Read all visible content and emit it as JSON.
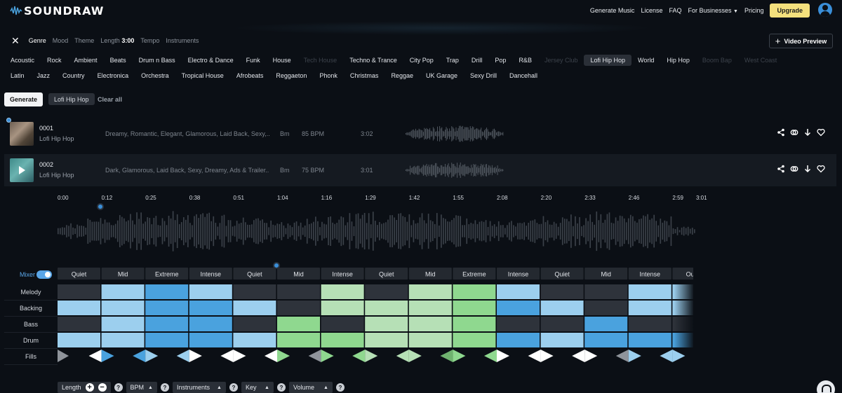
{
  "header": {
    "logo_text": "SOUNDRAW",
    "nav": [
      "Generate Music",
      "License",
      "FAQ",
      "For Businesses",
      "Pricing"
    ],
    "upgrade_label": "Upgrade"
  },
  "filters": {
    "genre": "Genre",
    "mood": "Mood",
    "theme": "Theme",
    "length_label": "Length",
    "length_value": "3:00",
    "tempo": "Tempo",
    "instruments": "Instruments",
    "video_preview": "Video Preview"
  },
  "genres_row1": [
    {
      "label": "Acoustic",
      "state": "normal"
    },
    {
      "label": "Rock",
      "state": "normal"
    },
    {
      "label": "Ambient",
      "state": "normal"
    },
    {
      "label": "Beats",
      "state": "normal"
    },
    {
      "label": "Drum n Bass",
      "state": "normal"
    },
    {
      "label": "Electro & Dance",
      "state": "normal"
    },
    {
      "label": "Funk",
      "state": "normal"
    },
    {
      "label": "House",
      "state": "normal"
    },
    {
      "label": "Tech House",
      "state": "dim"
    },
    {
      "label": "Techno & Trance",
      "state": "normal"
    },
    {
      "label": "City Pop",
      "state": "normal"
    },
    {
      "label": "Trap",
      "state": "normal"
    },
    {
      "label": "Drill",
      "state": "normal"
    },
    {
      "label": "Pop",
      "state": "normal"
    },
    {
      "label": "R&B",
      "state": "normal"
    },
    {
      "label": "Jersey Club",
      "state": "dim"
    },
    {
      "label": "Lofi Hip Hop",
      "state": "selected"
    },
    {
      "label": "World",
      "state": "normal"
    },
    {
      "label": "Hip Hop",
      "state": "normal"
    },
    {
      "label": "Boom Bap",
      "state": "dim"
    },
    {
      "label": "West Coast",
      "state": "dim"
    }
  ],
  "genres_row2": [
    {
      "label": "Latin",
      "state": "normal"
    },
    {
      "label": "Jazz",
      "state": "normal"
    },
    {
      "label": "Country",
      "state": "normal"
    },
    {
      "label": "Electronica",
      "state": "normal"
    },
    {
      "label": "Orchestra",
      "state": "normal"
    },
    {
      "label": "Tropical House",
      "state": "normal"
    },
    {
      "label": "Afrobeats",
      "state": "normal"
    },
    {
      "label": "Reggaeton",
      "state": "normal"
    },
    {
      "label": "Phonk",
      "state": "normal"
    },
    {
      "label": "Christmas",
      "state": "normal"
    },
    {
      "label": "Reggae",
      "state": "normal"
    },
    {
      "label": "UK Garage",
      "state": "normal"
    },
    {
      "label": "Sexy Drill",
      "state": "normal"
    },
    {
      "label": "Dancehall",
      "state": "normal"
    }
  ],
  "actions": {
    "generate": "Generate",
    "active_tag": "Lofi Hip Hop",
    "clear_all": "Clear all"
  },
  "tracks": [
    {
      "number": "0001",
      "genre": "Lofi Hip Hop",
      "tags": "Dreamy, Romantic, Elegant, Glamorous, Laid Back, Sexy,...",
      "key": "Bm",
      "bpm": "85 BPM",
      "duration": "3:02"
    },
    {
      "number": "0002",
      "genre": "Lofi Hip Hop",
      "tags": "Dark, Glamorous, Laid Back, Sexy, Dreamy, Ads & Trailer...",
      "key": "Bm",
      "bpm": "75 BPM",
      "duration": "3:01"
    }
  ],
  "timeline": [
    "0:00",
    "0:12",
    "0:25",
    "0:38",
    "0:51",
    "1:04",
    "1:16",
    "1:29",
    "1:42",
    "1:55",
    "2:08",
    "2:20",
    "2:33",
    "2:46",
    "2:59",
    "3:01"
  ],
  "mixer": {
    "label": "Mixer",
    "sections": [
      "Quiet",
      "Mid",
      "Extreme",
      "Intense",
      "Quiet",
      "Mid",
      "Intense",
      "Quiet",
      "Mid",
      "Extreme",
      "Intense",
      "Quiet",
      "Mid",
      "Intense",
      "Outro"
    ],
    "rows": [
      "Melody",
      "Backing",
      "Bass",
      "Drum",
      "Fills"
    ],
    "colors": {
      "off": "#2e333b",
      "light_blue": "#9ccfee",
      "blue": "#4aa2de",
      "light_green": "#b6e0b6",
      "green": "#8fd88f"
    },
    "cells": {
      "Melody": [
        "off",
        "light_blue",
        "blue",
        "light_blue",
        "off",
        "off",
        "light_green",
        "off",
        "light_green",
        "green",
        "light_blue",
        "off",
        "off",
        "light_blue",
        "light_blue"
      ],
      "Backing": [
        "light_blue",
        "light_blue",
        "blue",
        "blue",
        "light_blue",
        "off",
        "light_green",
        "light_green",
        "light_green",
        "green",
        "blue",
        "light_blue",
        "off",
        "light_blue",
        "light_blue"
      ],
      "Bass": [
        "off",
        "light_blue",
        "blue",
        "blue",
        "off",
        "green",
        "off",
        "light_green",
        "light_green",
        "green",
        "off",
        "off",
        "blue",
        "off",
        "off"
      ],
      "Drum": [
        "light_blue",
        "light_blue",
        "blue",
        "blue",
        "light_blue",
        "green",
        "green",
        "light_green",
        "light_green",
        "green",
        "blue",
        "light_blue",
        "blue",
        "blue",
        "blue"
      ]
    },
    "fills": [
      {
        "l": "#8f949b",
        "r": "#ffffff"
      },
      {
        "l": "#ffffff",
        "r": "#4aa2de"
      },
      {
        "l": "#4aa2de",
        "r": "#9ccfee"
      },
      {
        "l": "#9ccfee",
        "r": "#ffffff"
      },
      {
        "l": "#ffffff",
        "r": "#ffffff"
      },
      {
        "l": "#ffffff",
        "r": "#8fd88f"
      },
      {
        "l": "#8f949b",
        "r": "#8fd88f"
      },
      {
        "l": "#8fd88f",
        "r": "#b6e0b6"
      },
      {
        "l": "#b6e0b6",
        "r": "#b6e0b6"
      },
      {
        "l": "#6fb26f",
        "r": "#8fd88f"
      },
      {
        "l": "#8fd88f",
        "r": "#ffffff"
      },
      {
        "l": "#ffffff",
        "r": "#ffffff"
      },
      {
        "l": "#ffffff",
        "r": "#ffffff"
      },
      {
        "l": "#8f949b",
        "r": "#9ccfee"
      },
      {
        "l": "#9ccfee",
        "r": "#9ccfee"
      }
    ]
  },
  "bottom": {
    "length": "Length",
    "bpm": "BPM",
    "instruments": "Instruments",
    "key": "Key",
    "volume": "Volume"
  }
}
